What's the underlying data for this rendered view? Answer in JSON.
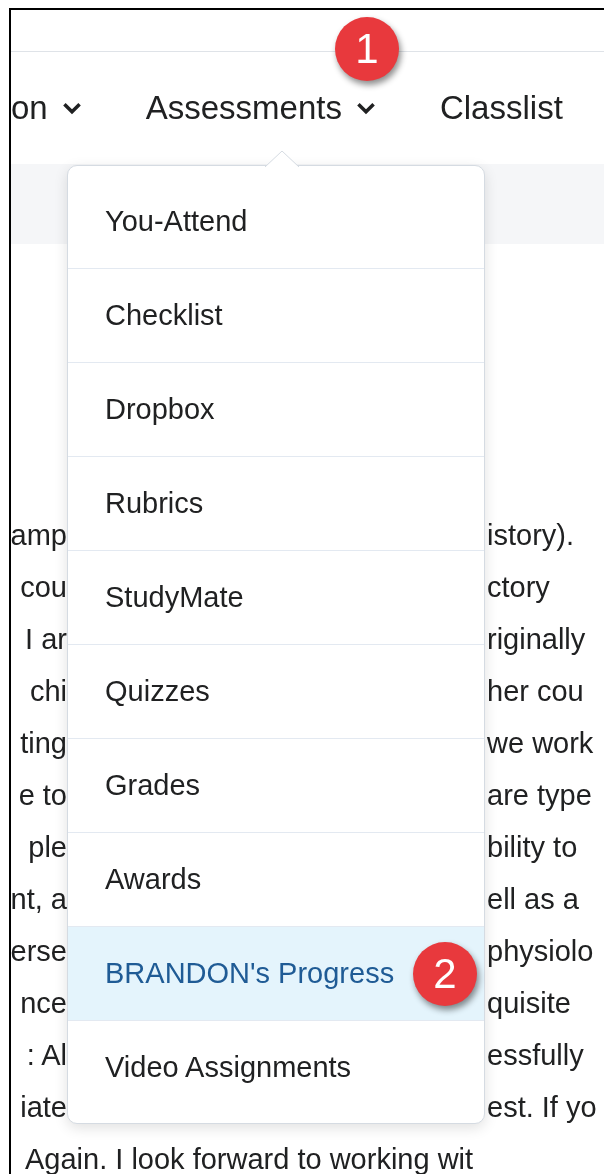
{
  "nav": [
    {
      "label": "on",
      "has_menu": true
    },
    {
      "label": "Assessments",
      "has_menu": true,
      "callout": "1"
    },
    {
      "label": "Classlist",
      "has_menu": false
    }
  ],
  "menu": {
    "items": [
      {
        "label": "You-Attend",
        "selected": false
      },
      {
        "label": "Checklist",
        "selected": false
      },
      {
        "label": "Dropbox",
        "selected": false
      },
      {
        "label": "Rubrics",
        "selected": false
      },
      {
        "label": "StudyMate",
        "selected": false
      },
      {
        "label": "Quizzes",
        "selected": false
      },
      {
        "label": "Grades",
        "selected": false
      },
      {
        "label": "Awards",
        "selected": false
      },
      {
        "label": "BRANDON's Progress",
        "selected": true,
        "callout": "2"
      },
      {
        "label": "Video Assignments",
        "selected": false
      }
    ]
  },
  "body_lines": [
    {
      "left": "amp",
      "right": "istory)."
    },
    {
      "left": "cou",
      "right": "ctory"
    },
    {
      "left": "I ar",
      "right": "riginally"
    },
    {
      "left": "chi",
      "right": "her cou"
    },
    {
      "left": "ting",
      "right": "we work"
    },
    {
      "left": "e to",
      "right": "are type"
    },
    {
      "left": "ple",
      "right": "bility to"
    },
    {
      "left": "nt, a",
      "right": "ell as a"
    },
    {
      "left": "erse",
      "right": "physiolo"
    },
    {
      "left": "nce",
      "right": "quisite"
    },
    {
      "left": ": Al",
      "right": "essfully"
    },
    {
      "left": "iate",
      "right": "est. If yo"
    }
  ],
  "body_last_line": "Again. I look forward to working wit"
}
